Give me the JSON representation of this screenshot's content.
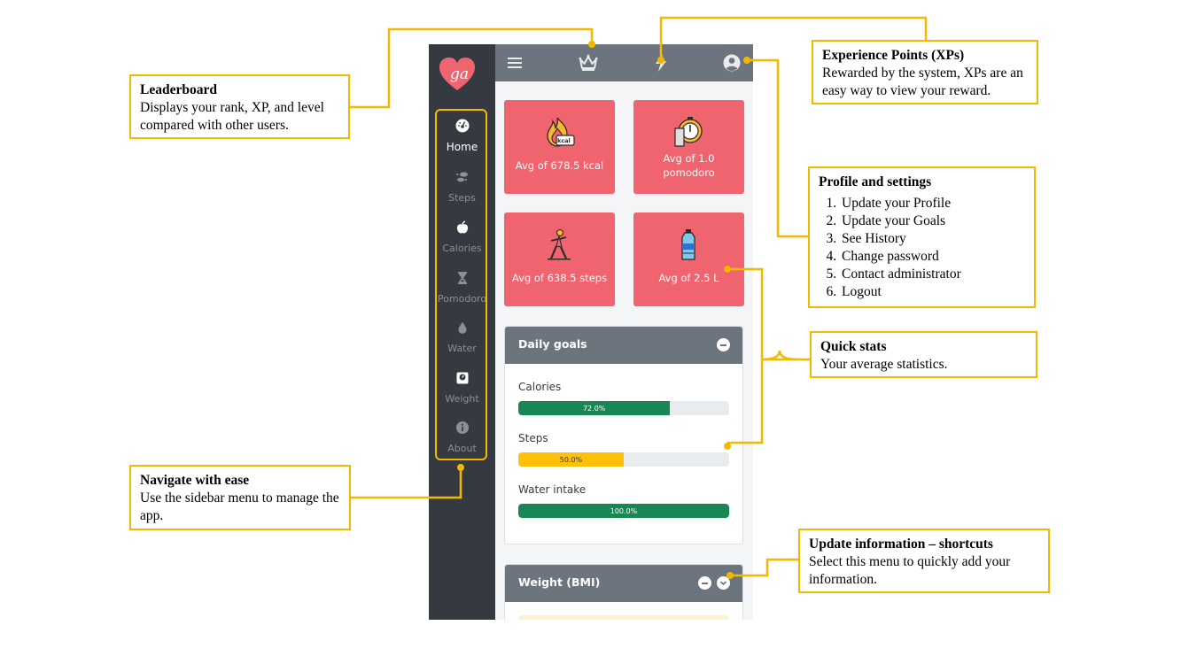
{
  "app": {
    "logo_text": "ga",
    "sidebar": {
      "items": [
        {
          "label": "Home",
          "icon": "dashboard-icon",
          "active": true
        },
        {
          "label": "Steps",
          "icon": "footsteps-icon",
          "active": false
        },
        {
          "label": "Calories",
          "icon": "apple-icon",
          "active": false
        },
        {
          "label": "Pomodoro",
          "icon": "hourglass-icon",
          "active": false
        },
        {
          "label": "Water",
          "icon": "water-drop-icon",
          "active": false
        },
        {
          "label": "Weight",
          "icon": "weight-scale-icon",
          "active": false
        },
        {
          "label": "About",
          "icon": "info-icon",
          "active": false
        }
      ]
    },
    "topbar": {
      "icons": [
        "menu-icon",
        "crown-icon",
        "lightning-icon",
        "user-circle-icon"
      ]
    },
    "quick_stats": [
      {
        "text": "Avg of 678.5 kcal",
        "icon": "calorie-fire-icon",
        "badge": "kcal"
      },
      {
        "text": "Avg of 1.0 pomodoro",
        "icon": "pomodoro-timer-icon"
      },
      {
        "text": "Avg of 638.5 steps",
        "icon": "runner-icon"
      },
      {
        "text": "Avg of 2.5 L",
        "icon": "water-bottle-icon"
      }
    ],
    "daily_goals": {
      "title": "Daily goals",
      "goals": [
        {
          "label": "Calories",
          "percent": 72.0,
          "percent_text": "72.0%",
          "color": "#198754"
        },
        {
          "label": "Steps",
          "percent": 50.0,
          "percent_text": "50.0%",
          "color": "#ffc107"
        },
        {
          "label": "Water intake",
          "percent": 100.0,
          "percent_text": "100.0%",
          "color": "#198754"
        }
      ]
    },
    "weight_panel": {
      "title": "Weight (BMI)"
    },
    "colors": {
      "card": "#f0646f",
      "sidebar": "#343a40",
      "header": "#6c757d",
      "highlight": "#f5b800"
    }
  },
  "annotations": {
    "leaderboard": {
      "title": "Leaderboard",
      "body": "Displays your rank, XP, and level compared with other users."
    },
    "xp": {
      "title": "Experience Points (XPs)",
      "body": "Rewarded by the system, XPs are an easy way to view your reward."
    },
    "profile": {
      "title": "Profile and settings",
      "items": [
        "Update your Profile",
        "Update your Goals",
        "See History",
        "Change password",
        "Contact administrator",
        "Logout"
      ]
    },
    "quick_stats": {
      "title": "Quick stats",
      "body": "Your average statistics."
    },
    "navigate": {
      "title": "Navigate with ease",
      "body": "Use the sidebar menu to manage the app."
    },
    "shortcuts": {
      "title": "Update information – shortcuts",
      "body": "Select this menu to quickly add your information."
    }
  }
}
